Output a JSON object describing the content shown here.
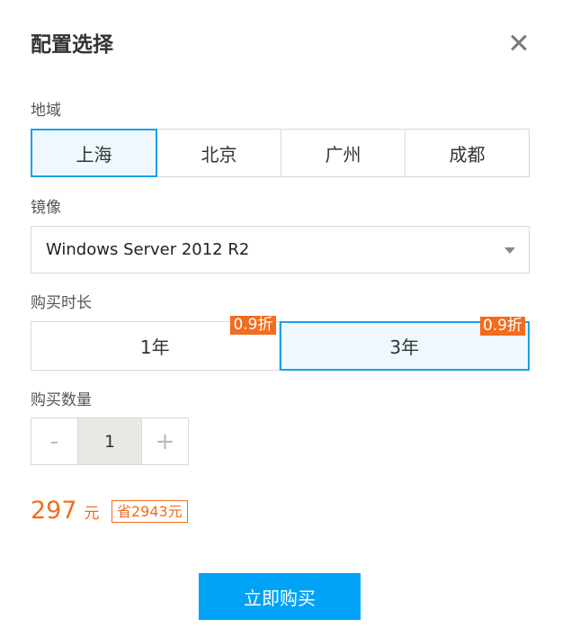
{
  "dialog": {
    "title": "配置选择",
    "close_icon": "close-icon"
  },
  "region": {
    "label": "地域",
    "options": [
      "上海",
      "北京",
      "广州",
      "成都"
    ],
    "selected": "上海"
  },
  "image": {
    "label": "镜像",
    "selected": "Windows Server 2012 R2",
    "dropdown_icon": "caret-down-icon"
  },
  "duration": {
    "label": "购买时长",
    "options": [
      {
        "label": "1年",
        "badge": "0.9折"
      },
      {
        "label": "3年",
        "badge": "0.9折"
      }
    ],
    "selected": "3年"
  },
  "quantity": {
    "label": "购买数量",
    "minus": "-",
    "value": "1",
    "plus": "+"
  },
  "price": {
    "amount": "297",
    "unit": "元",
    "saving": "省2943元"
  },
  "buy_button": "立即购买",
  "colors": {
    "accent": "#1aa0e6",
    "price": "#f36c1e",
    "button": "#00a2f5"
  }
}
